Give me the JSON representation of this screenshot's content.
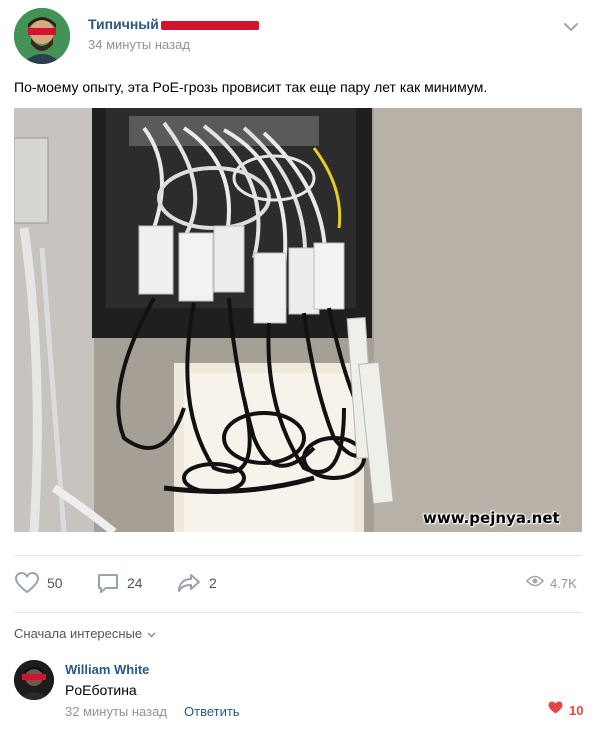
{
  "post": {
    "author": "Типичный",
    "time": "34 минуты назад",
    "text": "По-моему опыту, эта PoE-грозь провисит так еще пару лет как минимум.",
    "watermark": "www.pejnya.net"
  },
  "actions": {
    "likes": "50",
    "comments": "24",
    "shares": "2",
    "views": "4.7K"
  },
  "comments": {
    "sort_label": "Сначала интересные",
    "items": [
      {
        "author": "William White",
        "text": "PoEботина",
        "time": "32 минуты назад",
        "reply_label": "Ответить",
        "likes": "10"
      }
    ]
  },
  "colors": {
    "link": "#2a5885",
    "muted": "#939393",
    "like_red": "#e64646",
    "redaction": "#d2122e"
  },
  "icons": [
    "chevron-down-icon",
    "heart-icon",
    "comment-icon",
    "share-icon",
    "eye-icon",
    "red-heart-icon"
  ]
}
